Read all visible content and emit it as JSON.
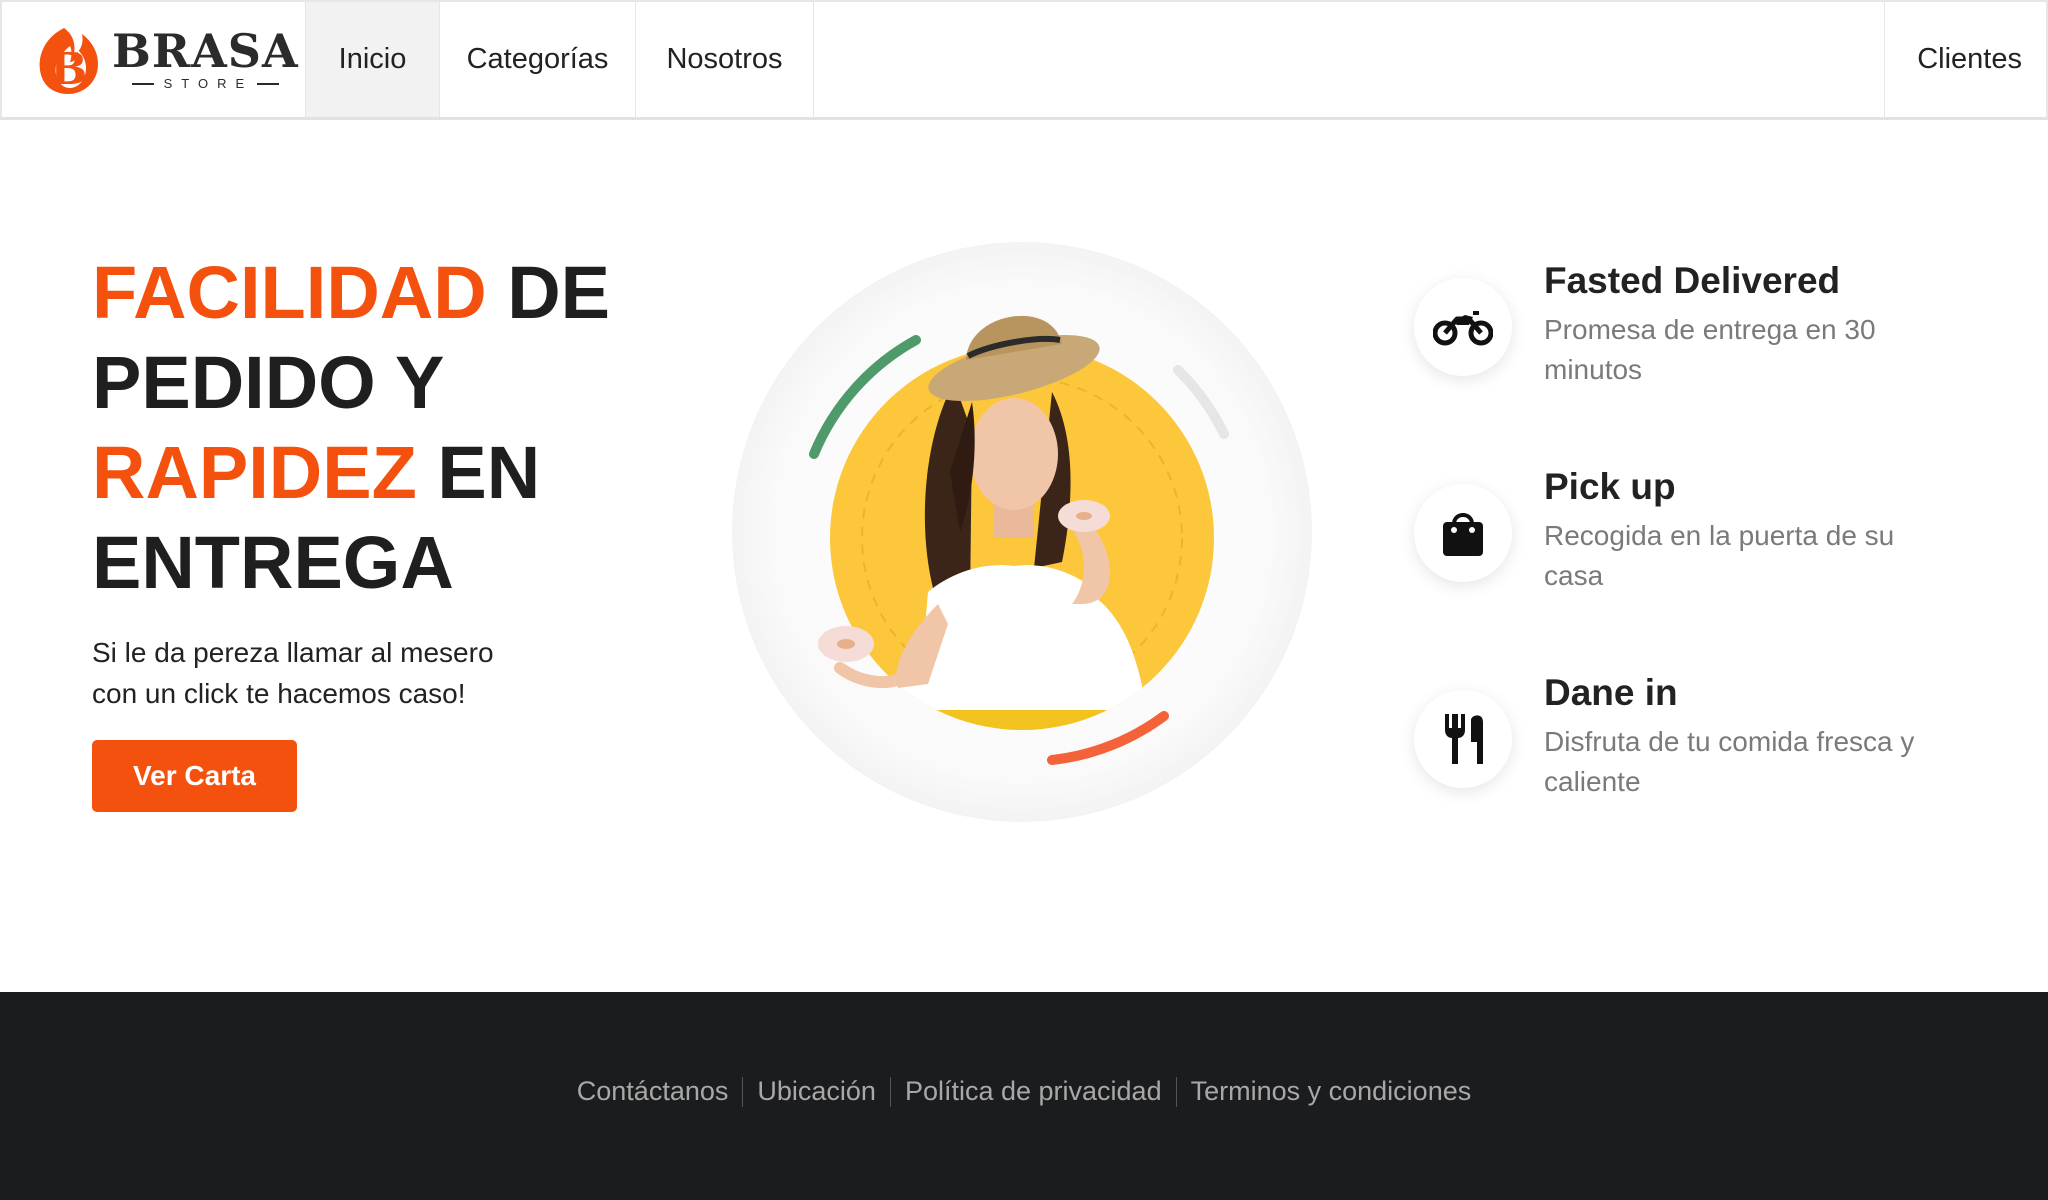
{
  "brand": {
    "name": "BRASA",
    "sub": "STORE",
    "mark_letter": "B"
  },
  "nav": {
    "inicio": "Inicio",
    "categorias": "Categorías",
    "nosotros": "Nosotros",
    "clientes": "Clientes"
  },
  "hero": {
    "title_accent_1": "FACILIDAD",
    "title_rest_1": " DE PEDIDO Y ",
    "title_accent_2": "RAPIDEZ",
    "title_rest_2": " EN ENTREGA",
    "subtitle": "Si le da pereza llamar al mesero con un click te hacemos caso!",
    "cta": "Ver Carta"
  },
  "features": [
    {
      "icon": "motorcycle-icon",
      "title": "Fasted Delivered",
      "desc": "Promesa de entrega en 30 minutos"
    },
    {
      "icon": "shopping-bag-icon",
      "title": "Pick up",
      "desc": "Recogida en la puerta de su casa"
    },
    {
      "icon": "utensils-icon",
      "title": "Dane in",
      "desc": "Disfruta de tu comida fresca y caliente"
    }
  ],
  "footer": {
    "links": [
      "Contáctanos",
      "Ubicación",
      "Política de privacidad",
      "Terminos y condiciones"
    ]
  },
  "colors": {
    "accent": "#f5510e",
    "footer_bg": "#1b1c1e",
    "yellow": "#fcc73a",
    "green_arc": "#4f9a6a",
    "red_arc": "#f4623a"
  }
}
